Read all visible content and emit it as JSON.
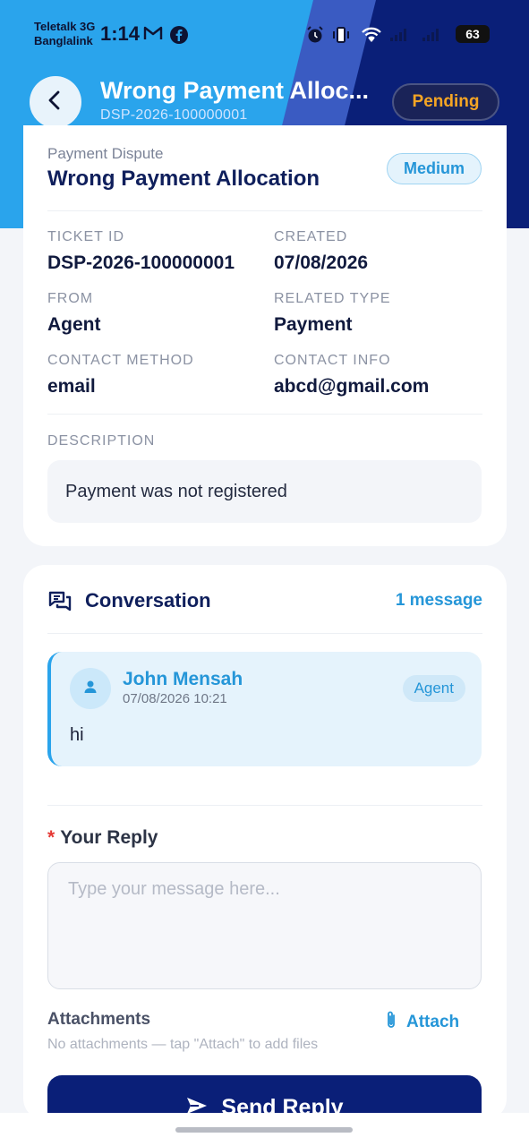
{
  "status_bar": {
    "carrier_1": "Teletalk 3G",
    "carrier_2": "Banglalink",
    "time": "1:14",
    "battery": "63"
  },
  "header": {
    "title": "Wrong Payment Alloc...",
    "subtitle": "DSP-2026-100000001",
    "status": "Pending"
  },
  "details": {
    "category": "Payment Dispute",
    "title": "Wrong Payment Allocation",
    "priority": "Medium",
    "fields": [
      {
        "label": "TICKET ID",
        "value": "DSP-2026-100000001"
      },
      {
        "label": "CREATED",
        "value": "07/08/2026"
      },
      {
        "label": "FROM",
        "value": "Agent"
      },
      {
        "label": "RELATED TYPE",
        "value": "Payment"
      },
      {
        "label": "CONTACT METHOD",
        "value": "email"
      },
      {
        "label": "CONTACT INFO",
        "value": "abcd@gmail.com"
      }
    ],
    "description_label": "DESCRIPTION",
    "description": "Payment was not registered"
  },
  "conversation": {
    "title": "Conversation",
    "count": "1 message",
    "messages": [
      {
        "author": "John Mensah",
        "timestamp": "07/08/2026 10:21",
        "role": "Agent",
        "body": "hi"
      }
    ]
  },
  "reply": {
    "label": "Your Reply",
    "required_mark": "*",
    "placeholder": "Type your message here...",
    "attachments_label": "Attachments",
    "attach_button": "Attach",
    "attachments_hint": "No attachments — tap \"Attach\" to add files",
    "send_button": "Send Reply"
  },
  "colors": {
    "header_light": "#2aa4ec",
    "header_dark": "#0a1f78",
    "accent": "#2596d8",
    "pending": "#f5a524",
    "title_navy": "#0f1f5c"
  },
  "icons": {
    "back": "arrow-left-icon",
    "conversation": "chat-bubbles-icon",
    "avatar": "person-icon",
    "attach": "paperclip-icon",
    "send": "send-icon"
  }
}
